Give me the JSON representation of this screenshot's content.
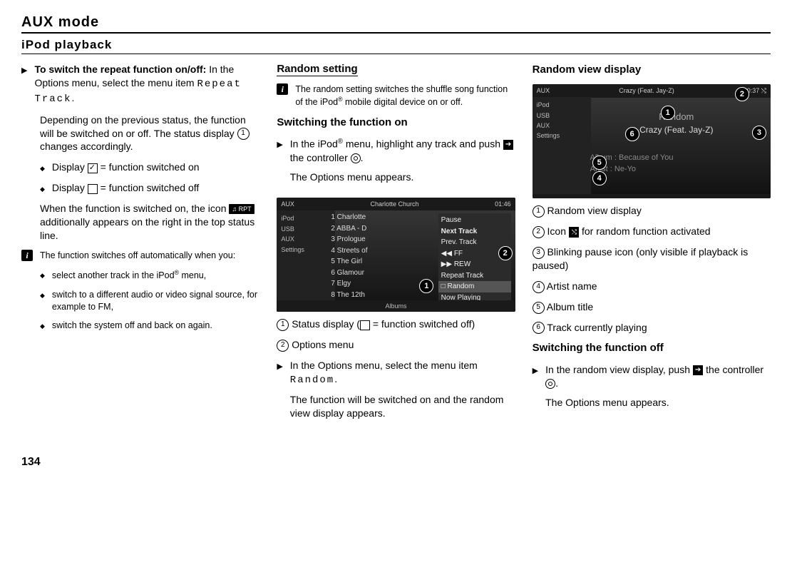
{
  "page": {
    "title": "AUX mode",
    "section": "iPod playback",
    "pageNumber": "134"
  },
  "col1": {
    "repeatHeading": "To switch the repeat function on/off:",
    "repeatBody": "In the Options menu, select the menu item ",
    "repeatItem": "Repeat Track",
    "repeatBodyEnd": ".",
    "dependPara": "Depending on the previous status, the function will be switched on or off. The status display ",
    "dependParaEnd": " changes accordingly.",
    "dispOn": "Display ",
    "dispOnEnd": " = function switched on",
    "dispOff": "Display ",
    "dispOffEnd": " = function switched off",
    "whenOn1": "When the function is switched on, the icon ",
    "whenOn2": " additionally appears on the right in the top status line.",
    "infoIntro": "The function switches off automatically when you:",
    "infoB1a": "select another track in the iPod",
    "infoB1b": " menu,",
    "infoB2": "switch to a different audio or video signal source, for example to FM,",
    "infoB3": "switch the system off and back on again.",
    "iconRpt": "♫ RPT"
  },
  "col2": {
    "heading": "Random setting",
    "infoNote1": "The random setting switches the shuffle song function of the iPod",
    "infoNote2": " mobile digital device on or off.",
    "switchOn": "Switching the function on",
    "step1a": "In the iPod",
    "step1b": " menu, highlight any track and push ",
    "step1c": " the controller ",
    "step1d": ".",
    "step1Result": "The Options menu appears.",
    "cap1a": "Status display (",
    "cap1b": " = function switched off)",
    "cap2": "Options menu",
    "step2": "In the Options menu, select the menu item ",
    "step2Item": "Random",
    "step2End": ".",
    "step2Result": "The function will be switched on and the random view display appears.",
    "shot": {
      "topLeft": "AUX",
      "topCenter": "Charlotte Church",
      "topRight": "01:46",
      "side": [
        "iPod",
        "USB",
        "AUX",
        "Settings"
      ],
      "list": [
        "1  Charlotte",
        "2  ABBA - D",
        "3  Prologue",
        "4  Streets of",
        "5  The Girl",
        "6  Glamour",
        "7  Elgy",
        "8  The 12th"
      ],
      "menu": [
        "Pause",
        "Next Track",
        "Prev. Track",
        "◀◀ FF",
        "▶▶ REW",
        "Repeat Track",
        "□ Random",
        "Now Playing"
      ],
      "bottomCenter": "Albums"
    }
  },
  "col3": {
    "heading": "Random view display",
    "cap1": "Random view display",
    "cap2a": "Icon ",
    "cap2b": " for random function activated",
    "cap3": "Blinking pause icon (only visible if playback is paused)",
    "cap4": "Artist name",
    "cap5": "Album title",
    "cap6": "Track currently playing",
    "switchOff": "Switching the function off",
    "step1a": "In the random view display, push ",
    "step1b": " the controller ",
    "step1c": ".",
    "step1Result": "The Options menu appears.",
    "shuffleIcon": "⤭",
    "shot": {
      "topLeft": "AUX",
      "topCenter": "Crazy (Feat. Jay-Z)",
      "topRight": "00:37  ⤭",
      "side": [
        "iPod",
        "USB",
        "AUX",
        "Settings"
      ],
      "randomLabel": "Random",
      "track": "Crazy (Feat. Jay-Z)",
      "album": "Album : Because of You",
      "artist": "Artist : Ne-Yo"
    }
  }
}
